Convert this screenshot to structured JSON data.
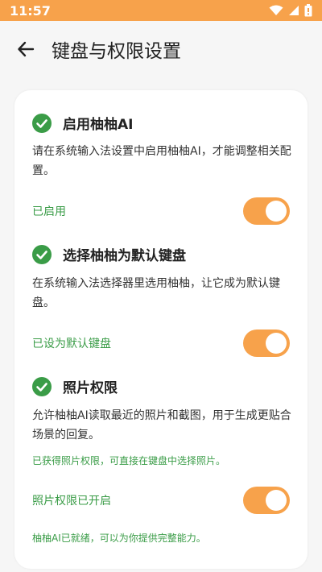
{
  "status_bar": {
    "time": "11:57"
  },
  "header": {
    "title": "键盘与权限设置"
  },
  "sections": [
    {
      "title": "启用柚柚AI",
      "description": "请在系统输入法设置中启用柚柚AI，才能调整相关配置。",
      "status_label": "已启用",
      "toggle_on": true
    },
    {
      "title": "选择柚柚为默认键盘",
      "description": "在系统输入法选择器里选用柚柚，让它成为默认键盘。",
      "status_label": "已设为默认键盘",
      "toggle_on": true
    },
    {
      "title": "照片权限",
      "description": "允许柚柚AI读取最近的照片和截图，用于生成更贴合场景的回复。",
      "note": "已获得照片权限，可直接在键盘中选择照片。",
      "status_label": "照片权限已开启",
      "toggle_on": true
    }
  ],
  "footer_note": "柚柚AI已就绪，可以为你提供完整能力。",
  "colors": {
    "accent": "#f7a24b",
    "success": "#3a9c47"
  },
  "icons": {
    "check": "check-circle-icon",
    "back": "back-arrow-icon"
  }
}
